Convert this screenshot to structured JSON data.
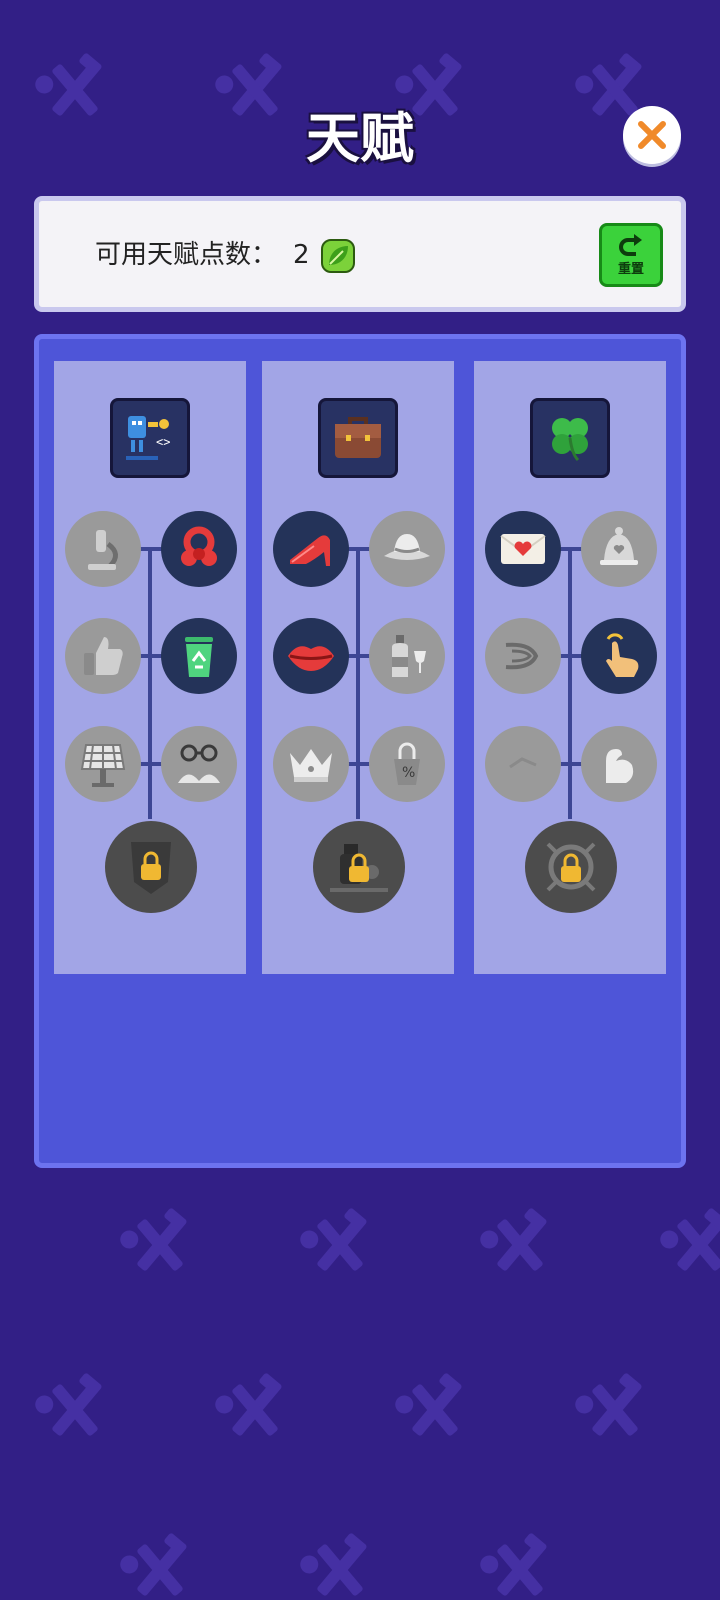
{
  "header": {
    "title": "天赋"
  },
  "points": {
    "label": "可用天赋点数：",
    "value": "2"
  },
  "reset": {
    "label": "重置"
  },
  "colors": {
    "background": "#321f86",
    "panel": "#4e55d8",
    "column": "#a2a5e6",
    "reset_green": "#3bd23b",
    "close_orange": "#f08a2a"
  },
  "columns": [
    {
      "header_icon": "robot-coding-icon",
      "nodes": [
        {
          "icon": "microscope-icon",
          "state": "locked"
        },
        {
          "icon": "red-ribbon-icon",
          "state": "unlocked"
        },
        {
          "icon": "thumbs-up-icon",
          "state": "locked"
        },
        {
          "icon": "recycle-bin-icon",
          "state": "unlocked"
        },
        {
          "icon": "solar-panel-icon",
          "state": "locked"
        },
        {
          "icon": "glasses-book-icon",
          "state": "locked"
        }
      ],
      "final": {
        "icon": "shield-icon",
        "state": "locked"
      }
    },
    {
      "header_icon": "briefcase-icon",
      "nodes": [
        {
          "icon": "high-heel-icon",
          "state": "unlocked"
        },
        {
          "icon": "sun-hat-icon",
          "state": "locked"
        },
        {
          "icon": "lips-icon",
          "state": "unlocked"
        },
        {
          "icon": "wine-bottle-icon",
          "state": "locked"
        },
        {
          "icon": "crown-icon",
          "state": "locked"
        },
        {
          "icon": "price-tag-icon",
          "state": "locked"
        }
      ],
      "final": {
        "icon": "gentleman-dog-icon",
        "state": "locked"
      }
    },
    {
      "header_icon": "four-leaf-clover-icon",
      "nodes": [
        {
          "icon": "love-letter-icon",
          "state": "unlocked"
        },
        {
          "icon": "bell-icon",
          "state": "locked"
        },
        {
          "icon": "speed-swirl-icon",
          "state": "locked"
        },
        {
          "icon": "tap-hand-icon",
          "state": "unlocked"
        },
        {
          "icon": "blank-icon",
          "state": "locked"
        },
        {
          "icon": "flexed-arm-icon",
          "state": "locked"
        }
      ],
      "final": {
        "icon": "gear-robot-icon",
        "state": "locked"
      }
    }
  ]
}
